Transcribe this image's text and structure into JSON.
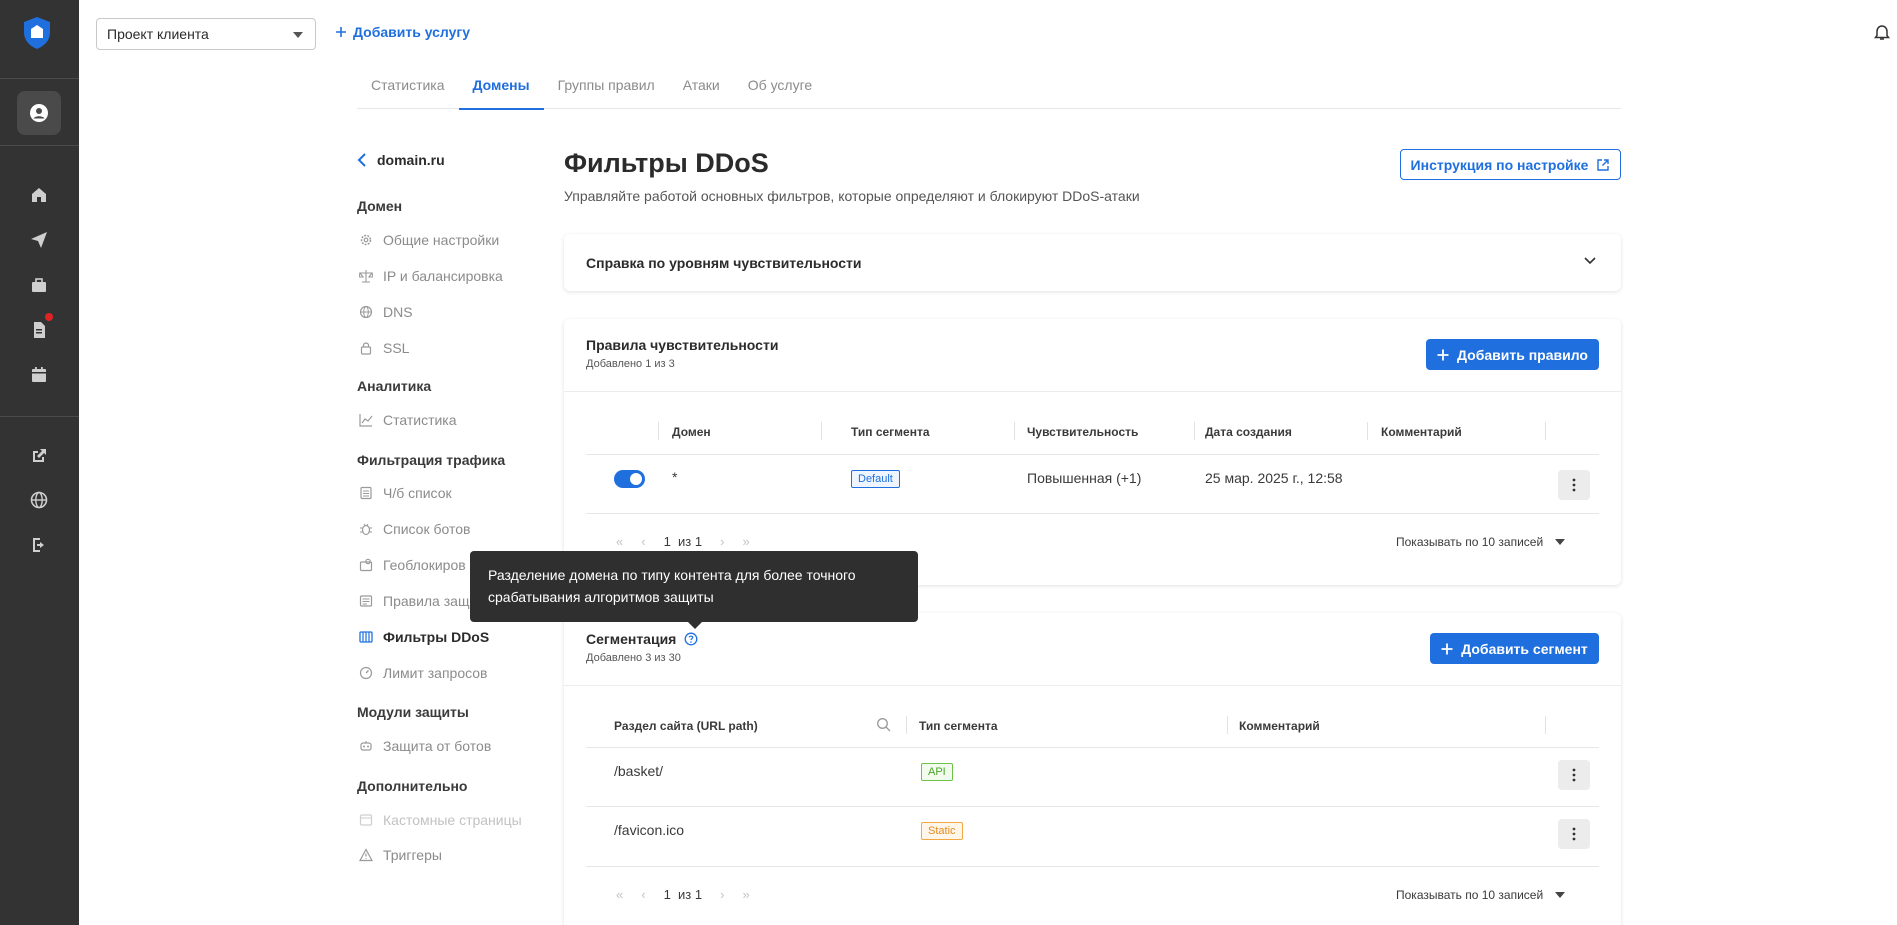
{
  "topbar": {
    "project_select": "Проект клиента",
    "add_service": "Добавить услугу"
  },
  "tabs": [
    {
      "label": "Статистика"
    },
    {
      "label": "Домены",
      "active": true
    },
    {
      "label": "Группы правил"
    },
    {
      "label": "Атаки"
    },
    {
      "label": "Об услуге"
    }
  ],
  "sidenav": {
    "back_label": "domain.ru",
    "sections": {
      "domain": "Домен",
      "analytics": "Аналитика",
      "traffic": "Фильтрация трафика",
      "modules": "Модули защиты",
      "extra": "Дополнительно"
    },
    "items": {
      "general": "Общие настройки",
      "ip": "IP и балансировка",
      "dns": "DNS",
      "ssl": "SSL",
      "stats": "Статистика",
      "bw": "Ч/б список",
      "bots": "Список ботов",
      "geo": "Геоблокиров",
      "rules": "Правила защ",
      "ddos": "Фильтры DDoS",
      "limit": "Лимит запросов",
      "botprot": "Защита от ботов",
      "custom": "Кастомные страницы",
      "triggers": "Триггеры"
    }
  },
  "main": {
    "title": "Фильтры DDoS",
    "subtitle": "Управляйте работой основных фильтров, которые определяют и блокируют DDoS-атаки",
    "guide_button": "Инструкция по настройке",
    "accordion": "Справка по уровням чувствительности"
  },
  "rules_card": {
    "title": "Правила чувствительности",
    "count": "Добавлено 1 из 3",
    "add_button": "Добавить правило",
    "columns": [
      "Домен",
      "Тип сегмента",
      "Чувствительность",
      "Дата создания",
      "Комментарий"
    ],
    "row": {
      "domain": "*",
      "segment": "Default",
      "sensitivity": "Повышенная (+1)",
      "created": "25 мар. 2025 г., 12:58",
      "comment": ""
    },
    "pager": {
      "page": "1",
      "of": "из 1",
      "per_page": "Показывать по 10 записей"
    }
  },
  "seg_card": {
    "title": "Сегментация",
    "count": "Добавлено 3 из 30",
    "add_button": "Добавить сегмент",
    "columns": [
      "Раздел сайта (URL path)",
      "Тип сегмента",
      "Комментарий"
    ],
    "rows": [
      {
        "path": "/basket/",
        "segment": "API"
      },
      {
        "path": "/favicon.ico",
        "segment": "Static"
      }
    ],
    "pager": {
      "page": "1",
      "of": "из 1",
      "per_page": "Показывать по 10 записей"
    }
  },
  "tooltip": {
    "line1": "Разделение домена по типу контента для более точного",
    "line2": "срабатывания алгоритмов защиты"
  },
  "colors": {
    "accent": "#1f6fde",
    "rail": "#333333",
    "tooltip": "#2f2f2f"
  }
}
